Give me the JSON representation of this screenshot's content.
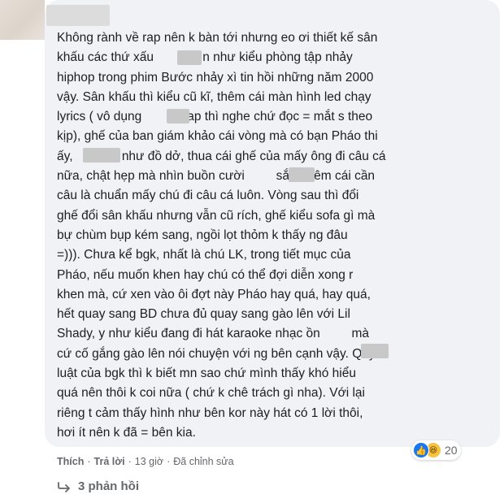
{
  "comment": {
    "text": "Không rành về rap nên k bàn tới nhưng eo ơi thiết kế sân\nkhấu các thứ xấu         nhìn như kiểu phòng tập nhảy\nhiphop trong phim Bước nhảy xì tin hồi những năm 2000\nvậy. Sân khấu thì kiểu cũ kĩ, thêm cái màn hình led chạy\nlyrics ( vô dụng        vì rap thì nghe chứ đọc = mắt s theo\nkịp), ghế của ban giám khảo cái vòng mà có bạn Pháo thi\nấy,              như đồ dở, thua cái ghế của mấy ông đi câu cá\nnữa, chật hẹp mà nhìn buồn cười         sắm thêm cái cần\ncâu là chuẩn mấy chú đi câu cá luôn. Vòng sau thì đổi\nghế đổi sân khấu nhưng vẫn cũ rích, ghế kiểu sofa gì mà\nbự chùm bụp kém sang, ngồi lọt thỏm k thấy ng đâu\n=))). Chưa kể bgk, nhất là chú LK, trong tiết mục của\nPháo, nếu muốn khen hay chú có thể đợi diễn xong r\nkhen mà, cứ xen vào ôi đợt này Pháo hay quá, hay quá,\nhết quay sang BD chưa đủ quay sang gào lên với Lil\nShady, y như kiểu đang đi hát karaoke nhạc ồn         mà\ncứ cố gắng gào lên nói chuyện với ng bên cạnh vậy. Quy\nluật của bgk thì k biết mn sao chứ mình thấy khó hiểu\nquá nên thôi k coi nữa ( chứ k chê trách gì nha). Với lại\nriêng t cảm thấy hình như bên kor này hát có 1 lời thôi,\nhơi ít nên k đã = bên kia."
  },
  "reactions": {
    "count": "20",
    "like_icon": "thumbs-up-icon",
    "haha_icon": "haha-face-icon",
    "like_color": "#1877f2",
    "haha_color": "#f7c440"
  },
  "actions": {
    "like_label": "Thích",
    "reply_label": "Trả lời",
    "time": "13 giờ",
    "edited": "Đã chỉnh sửa",
    "separator": "·"
  },
  "replies": {
    "label": "3 phản hồi",
    "icon": "reply-arrow-icon"
  },
  "colors": {
    "bubble": "#f0f2f5",
    "text": "#1c1e21",
    "meta": "#65676b"
  }
}
